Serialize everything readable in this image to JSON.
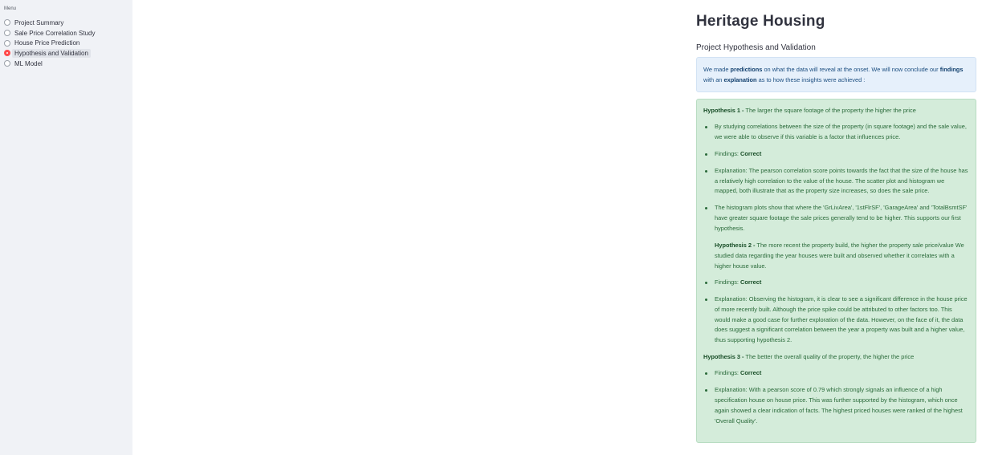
{
  "sidebar": {
    "menu_label": "Menu",
    "items": [
      {
        "label": "Project Summary",
        "selected": false
      },
      {
        "label": "Sale Price Correlation Study",
        "selected": false
      },
      {
        "label": "House Price Prediction",
        "selected": false
      },
      {
        "label": "Hypothesis and Validation",
        "selected": true
      },
      {
        "label": "ML Model",
        "selected": false
      }
    ],
    "accent_color": "#ff4b4b"
  },
  "main": {
    "title": "Heritage Housing",
    "subtitle": "Project Hypothesis and Validation",
    "info": {
      "t1": "We made ",
      "b1": "predictions",
      "t2": " on what the data will reveal at the onset. We will now conclude our ",
      "b2": "findings",
      "t3": " with an ",
      "b3": "explanation",
      "t4": " as to how these insights were achieved :"
    },
    "h1": {
      "label": "Hypothesis 1 -",
      "text": " The larger the square footage of the property the higher the price",
      "bullet1": "By studying correlations between the size of the property (in square footage) and the sale value, we were able to observe if this variable is a factor that influences price.",
      "findings_label": "Findings: ",
      "findings_value": "Correct",
      "explanation": "Explanation: The pearson correlation score points towards the fact that the size of the house has a relatively high correlation to the value of the house. The scatter plot and histogram we mapped, both illustrate that as the property size increases, so does the sale price.",
      "histogram": "The histogram plots show that where the 'GrLivArea', '1stFlrSF', 'GarageArea' and 'TotalBsmtSF' have greater square footage the sale prices generally tend to be higher. This supports our first hypothesis."
    },
    "h2": {
      "label": "Hypothesis 2 -",
      "text": " The more recent the property build, the higher the property sale price/value We studied data regarding the year houses were built and observed whether it correlates with a higher house value.",
      "findings_label": "Findings: ",
      "findings_value": "Correct",
      "explanation": "Explanation: Observing the histogram, it is clear to see a significant difference in the house price of more recently built. Although the price spike could be attributed to other factors too. This would make a good case for further exploration of the data. However, on the face of it, the data does suggest a significant correlation between the year a property was built and a higher value, thus supporting hypothesis 2."
    },
    "h3": {
      "label": "Hypothesis 3 -",
      "text": " The better the overall quality of the property, the higher the price",
      "findings_label": "Findings: ",
      "findings_value": "Correct",
      "explanation": "Explanation: With a pearson score of 0.79 which strongly signals an influence of a high specification house on house price. This was further supported by the histogram, which once again showed a clear indication of facts. The highest priced houses were ranked of the highest 'Overall Quality'."
    }
  }
}
